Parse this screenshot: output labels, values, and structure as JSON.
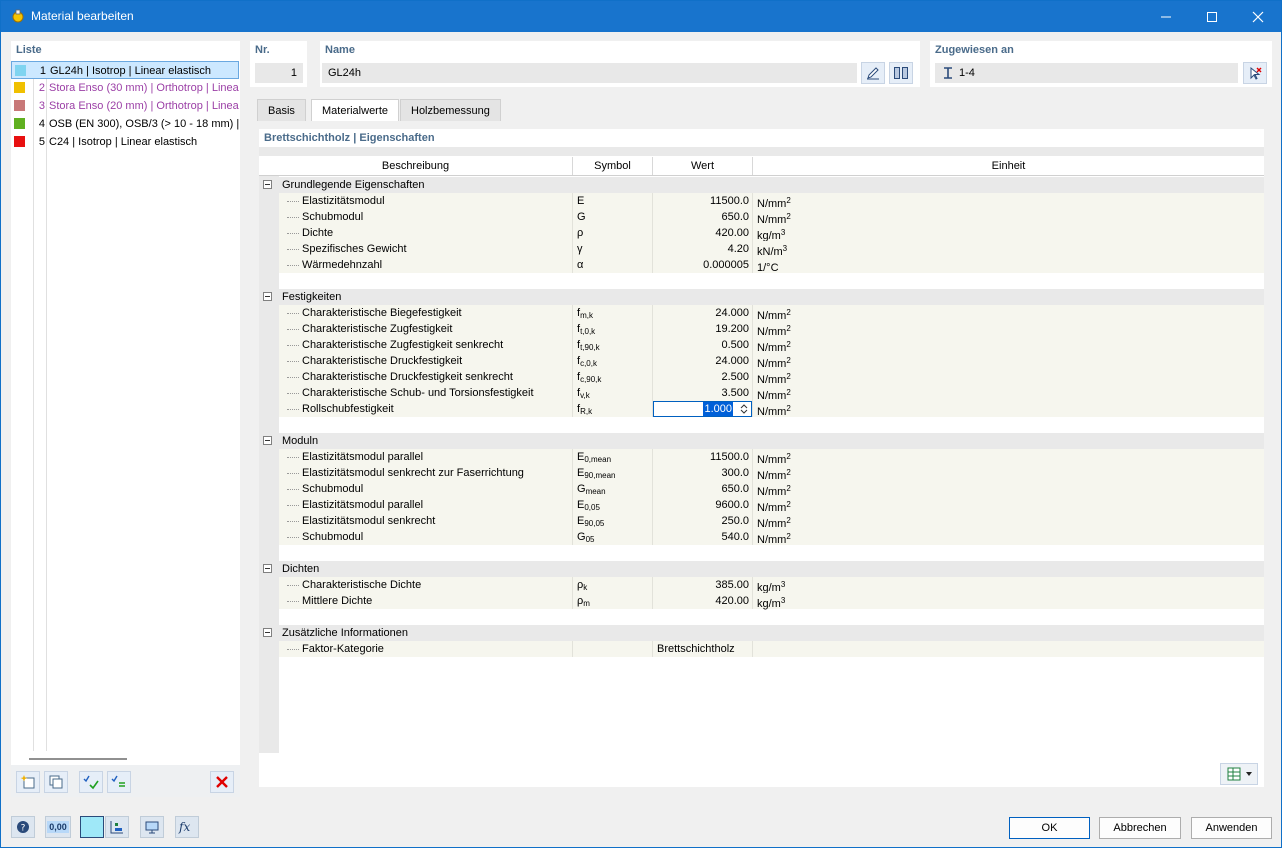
{
  "window": {
    "title": "Material bearbeiten"
  },
  "list": {
    "label": "Liste",
    "items": [
      {
        "num": "1",
        "text": "GL24h | Isotrop | Linear elastisch",
        "color": "#7fd4f0",
        "text_color": "#000000",
        "selected": true
      },
      {
        "num": "2",
        "text": "Stora Enso (30 mm) | Orthotrop | Linea",
        "color": "#f0c000",
        "text_color": "#9b3fa6",
        "selected": false
      },
      {
        "num": "3",
        "text": "Stora Enso (20 mm) | Orthotrop | Linea",
        "color": "#c87878",
        "text_color": "#9b3fa6",
        "selected": false
      },
      {
        "num": "4",
        "text": "OSB (EN 300), OSB/3 (> 10 - 18 mm) | O",
        "color": "#60b020",
        "text_color": "#000000",
        "selected": false
      },
      {
        "num": "5",
        "text": "C24 | Isotrop | Linear elastisch",
        "color": "#e81010",
        "text_color": "#000000",
        "selected": false
      }
    ]
  },
  "nr": {
    "label": "Nr.",
    "value": "1"
  },
  "name": {
    "label": "Name",
    "value": "GL24h"
  },
  "assigned": {
    "label": "Zugewiesen an",
    "value": "1-4"
  },
  "tabs": [
    {
      "label": "Basis",
      "active": false
    },
    {
      "label": "Materialwerte",
      "active": true
    },
    {
      "label": "Holzbemessung",
      "active": false
    }
  ],
  "section_title": "Brettschichtholz | Eigenschaften",
  "columns": {
    "description": "Beschreibung",
    "symbol": "Symbol",
    "value": "Wert",
    "unit": "Einheit"
  },
  "groups": [
    {
      "title": "Grundlegende Eigenschaften",
      "rows": [
        {
          "desc": "Elastizitätsmodul",
          "sym": "E",
          "sub": "",
          "value": "11500.0",
          "unit": "N/mm",
          "sup": "2"
        },
        {
          "desc": "Schubmodul",
          "sym": "G",
          "sub": "",
          "value": "650.0",
          "unit": "N/mm",
          "sup": "2"
        },
        {
          "desc": "Dichte",
          "sym": "ρ",
          "sub": "",
          "value": "420.00",
          "unit": "kg/m",
          "sup": "3"
        },
        {
          "desc": "Spezifisches Gewicht",
          "sym": "γ",
          "sub": "",
          "value": "4.20",
          "unit": "kN/m",
          "sup": "3"
        },
        {
          "desc": "Wärmedehnzahl",
          "sym": "α",
          "sub": "",
          "value": "0.000005",
          "unit": "1/°C",
          "sup": ""
        }
      ]
    },
    {
      "title": "Festigkeiten",
      "rows": [
        {
          "desc": "Charakteristische Biegefestigkeit",
          "sym": "f",
          "sub": "m,k",
          "value": "24.000",
          "unit": "N/mm",
          "sup": "2"
        },
        {
          "desc": "Charakteristische Zugfestigkeit",
          "sym": "f",
          "sub": "t,0,k",
          "value": "19.200",
          "unit": "N/mm",
          "sup": "2"
        },
        {
          "desc": "Charakteristische Zugfestigkeit senkrecht",
          "sym": "f",
          "sub": "t,90,k",
          "value": "0.500",
          "unit": "N/mm",
          "sup": "2"
        },
        {
          "desc": "Charakteristische Druckfestigkeit",
          "sym": "f",
          "sub": "c,0,k",
          "value": "24.000",
          "unit": "N/mm",
          "sup": "2"
        },
        {
          "desc": "Charakteristische Druckfestigkeit senkrecht",
          "sym": "f",
          "sub": "c,90,k",
          "value": "2.500",
          "unit": "N/mm",
          "sup": "2"
        },
        {
          "desc": "Charakteristische Schub- und Torsionsfestigkeit",
          "sym": "f",
          "sub": "v,k",
          "value": "3.500",
          "unit": "N/mm",
          "sup": "2"
        },
        {
          "desc": "Rollschubfestigkeit",
          "sym": "f",
          "sub": "R,k",
          "value": "1.000",
          "unit": "N/mm",
          "sup": "2",
          "editing": true
        }
      ]
    },
    {
      "title": "Moduln",
      "rows": [
        {
          "desc": "Elastizitätsmodul parallel",
          "sym": "E",
          "sub": "0,mean",
          "value": "11500.0",
          "unit": "N/mm",
          "sup": "2"
        },
        {
          "desc": "Elastizitätsmodul senkrecht zur Faserrichtung",
          "sym": "E",
          "sub": "90,mean",
          "value": "300.0",
          "unit": "N/mm",
          "sup": "2"
        },
        {
          "desc": "Schubmodul",
          "sym": "G",
          "sub": "mean",
          "value": "650.0",
          "unit": "N/mm",
          "sup": "2"
        },
        {
          "desc": "Elastizitätsmodul parallel",
          "sym": "E",
          "sub": "0,05",
          "value": "9600.0",
          "unit": "N/mm",
          "sup": "2"
        },
        {
          "desc": "Elastizitätsmodul senkrecht",
          "sym": "E",
          "sub": "90,05",
          "value": "250.0",
          "unit": "N/mm",
          "sup": "2"
        },
        {
          "desc": "Schubmodul",
          "sym": "G",
          "sub": "05",
          "value": "540.0",
          "unit": "N/mm",
          "sup": "2"
        }
      ]
    },
    {
      "title": "Dichten",
      "rows": [
        {
          "desc": "Charakteristische Dichte",
          "sym": "ρ",
          "sub": "k",
          "value": "385.00",
          "unit": "kg/m",
          "sup": "3"
        },
        {
          "desc": "Mittlere Dichte",
          "sym": "ρ",
          "sub": "m",
          "value": "420.00",
          "unit": "kg/m",
          "sup": "3"
        }
      ]
    },
    {
      "title": "Zusätzliche Informationen",
      "rows": [
        {
          "desc": "Faktor-Kategorie",
          "sym": "",
          "sub": "",
          "value": "Brettschichtholz",
          "unit": "",
          "sup": "",
          "text_value": true
        }
      ]
    }
  ],
  "buttons": {
    "ok": "OK",
    "cancel": "Abbrechen",
    "apply": "Anwenden"
  },
  "bottom_icons": {
    "units_label": "0,00"
  }
}
